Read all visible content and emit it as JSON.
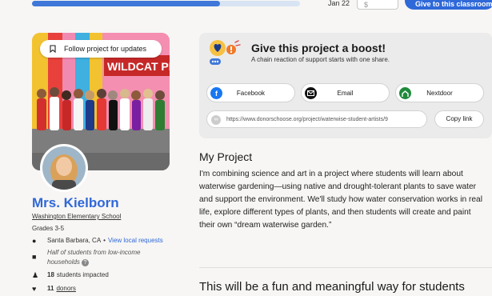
{
  "topbar": {
    "progress_fraction": 0.7,
    "date": "Jan 22",
    "amount_placeholder": "$",
    "give_button": "Give to this classroom"
  },
  "photo": {
    "follow_label": "Follow project for updates",
    "banner_text": "WILDCAT PR"
  },
  "teacher": {
    "name": "Mrs. Kielborn",
    "school": "Washington Elementary School",
    "grades": "Grades 3-5",
    "location": "Santa Barbara, CA",
    "location_sep": "•",
    "location_link": "View local requests",
    "income_note": "Half of students from low‑income households",
    "students_count": "18",
    "students_label": "students impacted",
    "donors_count": "11",
    "donors_label": "donors"
  },
  "boost": {
    "title": "Give this project a boost!",
    "subtitle": "A chain reaction of support starts with one share.",
    "buttons": [
      {
        "label": "Facebook",
        "icon": "facebook-icon",
        "color": "#1877f2"
      },
      {
        "label": "Email",
        "icon": "envelope-icon",
        "color": "#111111"
      },
      {
        "label": "Nextdoor",
        "icon": "nextdoor-icon",
        "color": "#1f8a3c"
      }
    ],
    "url": "https://www.donorschoose.org/project/waterwise-student-artists/9",
    "copy_label": "Copy link"
  },
  "project": {
    "heading": "My Project",
    "body": "I'm combining science and art in a project where students will learn about waterwise gardening—using native and drought-tolerant plants to save water and support the environment. We'll study how water conservation works in real life, explore different types of plants, and then students will create and paint their own “dream waterwise garden.”",
    "next_line": "This will be a fun and meaningful way for students"
  },
  "colors": {
    "brand_blue": "#2f68d8",
    "card_gray": "#ebebeb"
  }
}
